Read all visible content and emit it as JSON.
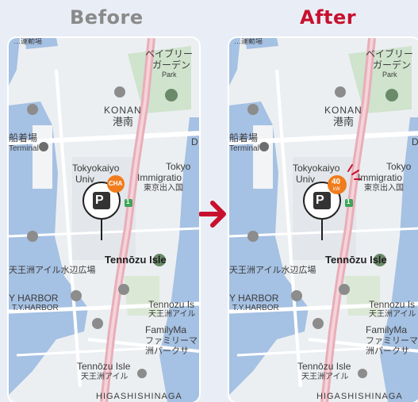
{
  "header": {
    "before": "Before",
    "after": "After"
  },
  "map_labels": {
    "top_left": "…運動場",
    "park_jp_1": "ベイブリー",
    "park_jp_2": "ガーデン",
    "park_en": "Park",
    "konan_en": "KONAN",
    "konan_jp": "港南",
    "terminal_jp": "船着場",
    "terminal_en": "Terminal",
    "d_label": "D",
    "tokyokaiyo": "Tokyokaiyo",
    "univ": "Univ",
    "tokyo_right": "Tokyo",
    "immigration": "Immigratio",
    "immigration_jp": "東京出入国",
    "tennozu_isle": "Tennōzu Isle",
    "tennozu_jp": "天王洲アイル水辺広場",
    "harbor_en": "Y HARBOR",
    "harbor_sub": "T.Y.HARBOR",
    "tennozu_is_1": "Tennozu Is",
    "tennozu_is_jp": "天王洲アイル",
    "familymart": "FamilyMa",
    "familymart_jp_1": "ファミリーマ",
    "familymart_jp_2": "洲パークサ",
    "tennozu_bottom": "Tennōzu Isle",
    "tennozu_bottom_jp": "天王洲アイル",
    "higashi": "HIGASHISHINAGA",
    "route_number": "1"
  },
  "markers": {
    "before_badge": "CHA",
    "after_value": "40",
    "after_unit": "kW",
    "parking_letter": "P"
  },
  "colors": {
    "water": "#a5c1e3",
    "land": "#eceff2",
    "road": "#ffffff",
    "main_road": "#e8aeb9",
    "green": "#cfe3cd",
    "accent_red": "#c8102e",
    "badge_orange": "#f07c1d"
  }
}
